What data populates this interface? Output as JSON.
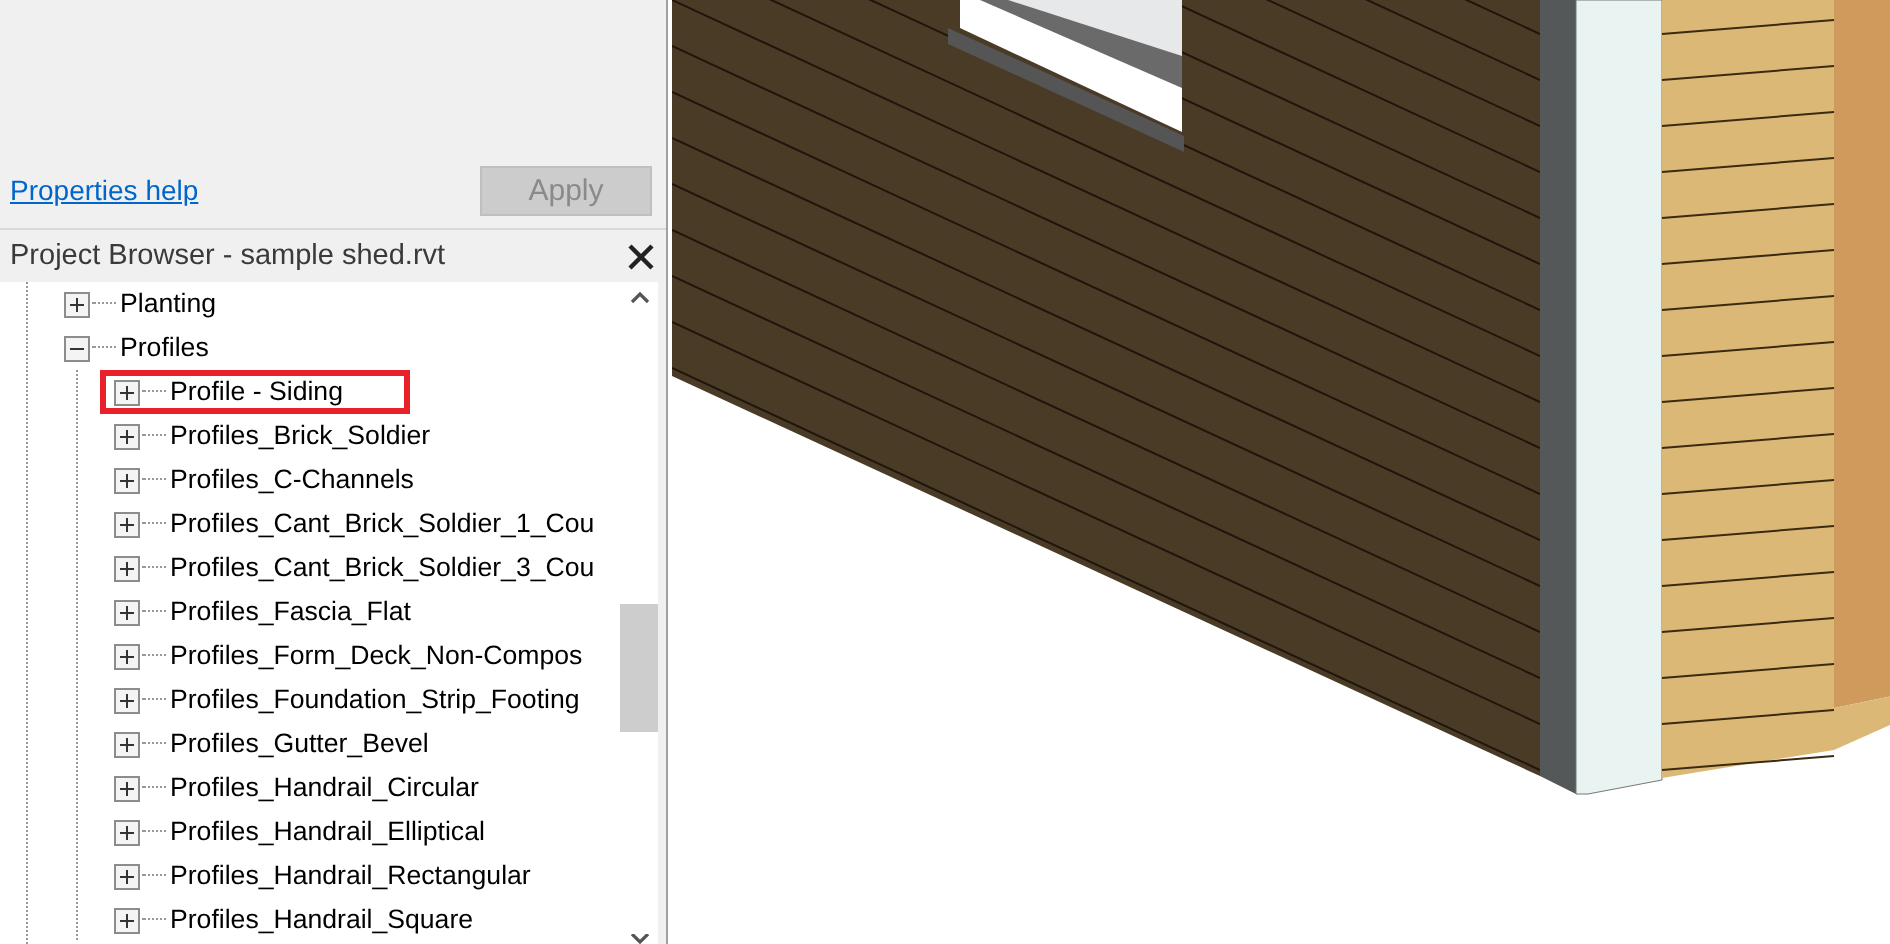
{
  "properties": {
    "help_link": "Properties help",
    "apply_button": {
      "label": "Apply",
      "disabled": true
    }
  },
  "project_browser": {
    "title": "Project Browser - sample shed.rvt",
    "tree": [
      {
        "label": "Planting",
        "expanded": false
      },
      {
        "label": "Profiles",
        "expanded": true,
        "children": [
          {
            "label": "Profile - Siding",
            "expanded": false,
            "highlighted": true
          },
          {
            "label": "Profiles_Brick_Soldier",
            "expanded": false
          },
          {
            "label": "Profiles_C-Channels",
            "expanded": false
          },
          {
            "label": "Profiles_Cant_Brick_Soldier_1_Cou",
            "expanded": false
          },
          {
            "label": "Profiles_Cant_Brick_Soldier_3_Cou",
            "expanded": false
          },
          {
            "label": "Profiles_Fascia_Flat",
            "expanded": false
          },
          {
            "label": "Profiles_Form_Deck_Non-Compos",
            "expanded": false
          },
          {
            "label": "Profiles_Foundation_Strip_Footing",
            "expanded": false
          },
          {
            "label": "Profiles_Gutter_Bevel",
            "expanded": false
          },
          {
            "label": "Profiles_Handrail_Circular",
            "expanded": false
          },
          {
            "label": "Profiles_Handrail_Elliptical",
            "expanded": false
          },
          {
            "label": "Profiles_Handrail_Rectangular",
            "expanded": false
          },
          {
            "label": "Profiles_Handrail_Square",
            "expanded": false
          }
        ]
      }
    ]
  }
}
